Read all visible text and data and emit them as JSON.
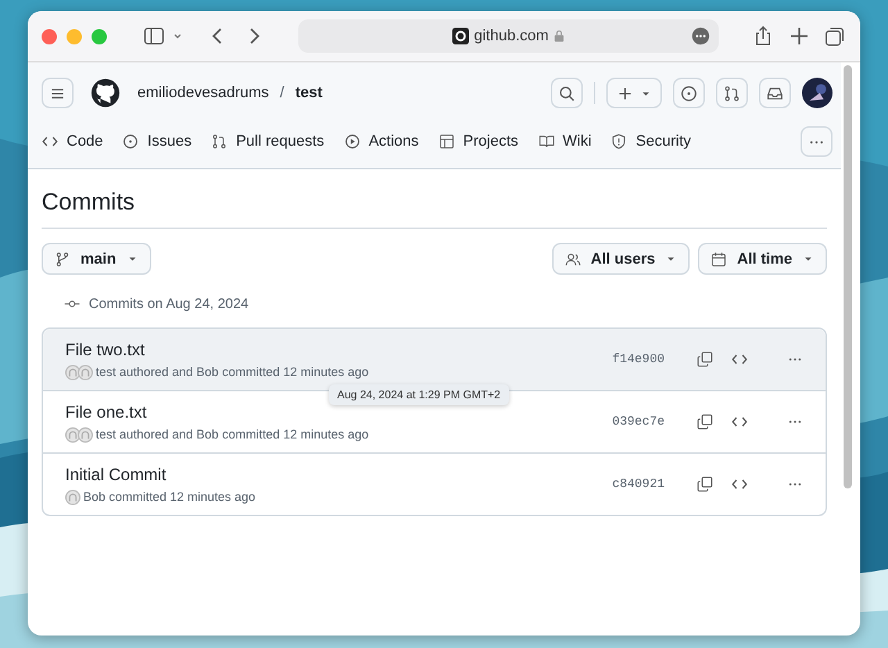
{
  "browser": {
    "address": "github.com"
  },
  "repo": {
    "owner": "emiliodevesadrums",
    "separator": "/",
    "name": "test"
  },
  "nav": [
    {
      "label": "Code"
    },
    {
      "label": "Issues"
    },
    {
      "label": "Pull requests"
    },
    {
      "label": "Actions"
    },
    {
      "label": "Projects"
    },
    {
      "label": "Wiki"
    },
    {
      "label": "Security"
    }
  ],
  "page_title": "Commits",
  "branch": "main",
  "filters": [
    {
      "label": "All users"
    },
    {
      "label": "All time"
    }
  ],
  "group_heading": "Commits on Aug 24, 2024",
  "commits": [
    {
      "title": "File two.txt",
      "meta": "test authored and Bob committed 12 minutes ago",
      "kind": "co-authored",
      "sha": "f14e900",
      "highlighted": true
    },
    {
      "title": "File one.txt",
      "meta": "test authored and Bob committed 12 minutes ago",
      "kind": "co-authored",
      "sha": "039ec7e",
      "highlighted": false
    },
    {
      "title": "Initial Commit",
      "meta": "Bob committed 12 minutes ago",
      "kind": "single",
      "sha": "c840921",
      "highlighted": false
    }
  ],
  "tooltip": "Aug 24, 2024 at 1:29 PM GMT+2"
}
